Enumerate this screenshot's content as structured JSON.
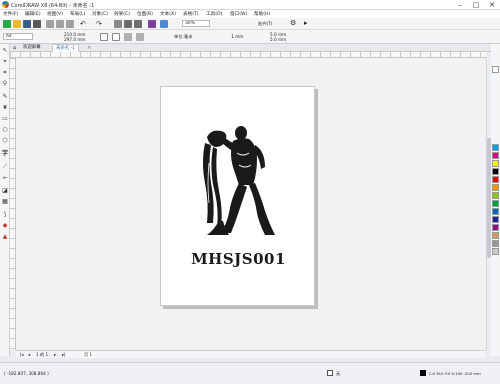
{
  "window": {
    "title": "CorelDRAW X8 (64-Bit) - 未命名 -1"
  },
  "menu": [
    "文件(F)",
    "编辑(E)",
    "视图(V)",
    "布局(L)",
    "对象(C)",
    "效果(C)",
    "位图(B)",
    "文本(X)",
    "表格(T)",
    "工具(O)",
    "窗口(W)",
    "帮助(H)"
  ],
  "standard_toolbar": {
    "zoom": "30%",
    "snap_label": "贴齐(T)"
  },
  "property_bar": {
    "paper": "A4",
    "width": "210.0 mm",
    "height": "297.0 mm",
    "units_label": "单位:",
    "units": "毫米",
    "nudge": ".1 mm",
    "dup_x": "5.0 mm",
    "dup_y": "5.0 mm"
  },
  "tabs": [
    "欢迎屏幕",
    "未命名 -1"
  ],
  "artwork": {
    "text": "MHSJS001"
  },
  "page_nav": {
    "current": "1 的 1",
    "page_tab": "页 1"
  },
  "status": {
    "coords": "( -182.807, 308.864 )",
    "fill_none": "无",
    "color_info": "C:0 M:0 Y:0 K:100 .200 mm"
  },
  "colors": {
    "accent": "#1e6fd9",
    "ink": "#1a1a1a"
  }
}
